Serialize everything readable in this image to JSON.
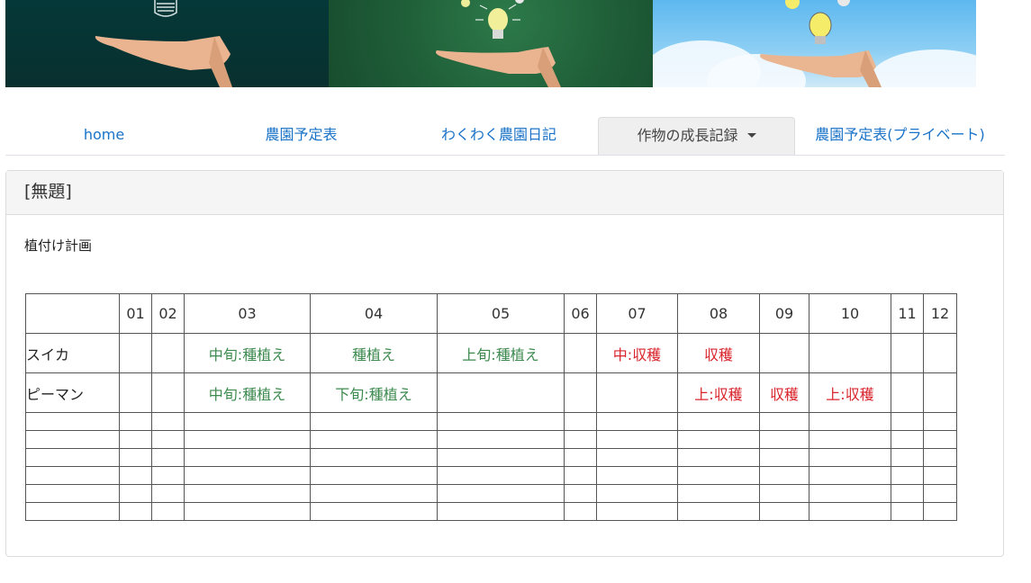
{
  "nav": {
    "tabs": [
      {
        "label": "home"
      },
      {
        "label": "農園予定表"
      },
      {
        "label": "わくわく農園日記"
      },
      {
        "label": "作物の成長記録"
      },
      {
        "label": "農園予定表(プライベート)"
      }
    ],
    "active_index": 3
  },
  "card": {
    "title": "[無題]",
    "subtitle": "植付け計画"
  },
  "table": {
    "months": [
      "01",
      "02",
      "03",
      "04",
      "05",
      "06",
      "07",
      "08",
      "09",
      "10",
      "11",
      "12"
    ],
    "rows": [
      {
        "name": "スイカ",
        "cells": [
          "",
          "",
          "中旬:種植え",
          "種植え",
          "上旬:種植え",
          "",
          "中:収穫",
          "収穫",
          "",
          "",
          "",
          ""
        ]
      },
      {
        "name": "ピーマン",
        "cells": [
          "",
          "",
          "中旬:種植え",
          "下旬:種植え",
          "",
          "",
          "",
          "上:収穫",
          "収穫",
          "上:収穫",
          "",
          ""
        ]
      }
    ],
    "blank_rows": 6
  },
  "colors": {
    "link": "#1a73c8",
    "sowing": "#3d8a4f",
    "harvest": "#d9242c"
  }
}
